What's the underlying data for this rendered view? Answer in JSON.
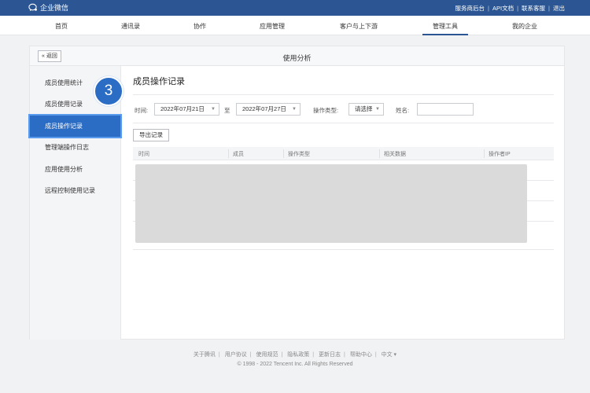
{
  "topbar": {
    "app_name": "企业微信",
    "links": [
      "服务商后台",
      "API文档",
      "联系客服",
      "退出"
    ]
  },
  "nav": {
    "items": [
      "首页",
      "通讯录",
      "协作",
      "应用管理",
      "客户与上下游",
      "管理工具",
      "我的企业"
    ],
    "active": "管理工具"
  },
  "panel": {
    "back_label": "« 返回",
    "title": "使用分析"
  },
  "sidebar": {
    "items": [
      "成员使用统计",
      "成员使用记录",
      "成员操作记录",
      "管理端操作日志",
      "应用使用分析",
      "远程控制使用记录"
    ],
    "active": "成员操作记录"
  },
  "step_badge": "3",
  "content": {
    "title": "成员操作记录",
    "filters": {
      "time_label": "时间:",
      "start_date": "2022年07月21日",
      "to_label": "至",
      "end_date": "2022年07月27日",
      "op_type_label": "操作类型:",
      "op_type_value": "请选择",
      "name_label": "姓名:",
      "name_value": ""
    },
    "export_label": "导出记录",
    "table": {
      "columns": [
        "时间",
        "成员",
        "操作类型",
        "相关数据",
        "操作者IP"
      ]
    }
  },
  "footer": {
    "links": [
      "关于腾讯",
      "用户协议",
      "使用规范",
      "隐私政策",
      "更新日志",
      "帮助中心",
      "中文 ▾"
    ],
    "copyright": "© 1998 - 2022 Tencent Inc. All Rights Reserved"
  },
  "colors": {
    "brand": "#2b5693",
    "active_item": "#2b6cc4"
  }
}
